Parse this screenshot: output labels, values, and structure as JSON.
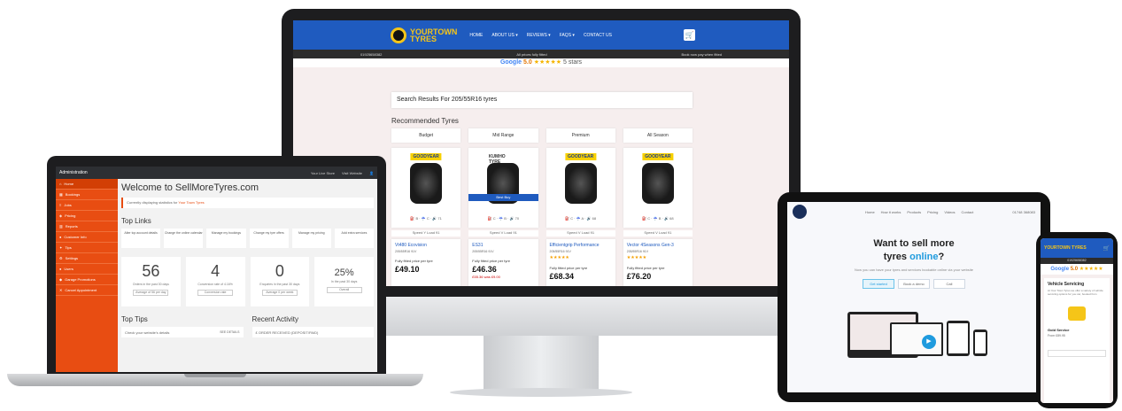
{
  "imac": {
    "logo_line1": "YOURTOWN",
    "logo_line2": "TYRES",
    "menu": [
      "HOME",
      "ABOUT US ▾",
      "REVIEWS ▾",
      "FAQS ▾",
      "CONTACT US"
    ],
    "strip": [
      "01925658382",
      "All prices fully fitted",
      "Book now pay when fitted"
    ],
    "rating": {
      "brand": "Google",
      "score": "5.0",
      "stars": "★★★★★",
      "count": "5 stars"
    },
    "search_title": "Search Results For 205/55R16 tyres",
    "recommended": "Recommended Tyres",
    "columns": [
      {
        "header": "Budget",
        "brand": "GOODYEAR",
        "best_buy": "",
        "speed": "Speed Y    Load 91",
        "name": "Vt480 Ecovision",
        "size": "205/55R16 91V",
        "stars": "",
        "fitted": "Fully fitted price per tyre",
        "price": "£49.10",
        "old": ""
      },
      {
        "header": "Mid Range",
        "brand": "KUMHO TYRE",
        "best_buy": "Best Buy",
        "speed": "Speed V    Load 91",
        "name": "ES31",
        "size": "205/55R16 91V",
        "stars": "",
        "fitted": "Fully fitted price per tyre",
        "price": "£46.36",
        "old": "£55.36 was £9.00"
      },
      {
        "header": "Premium",
        "brand": "GOODYEAR",
        "best_buy": "",
        "speed": "Speed V    Load 91",
        "name": "Efficientgrip Performance",
        "size": "205/55R16 91V",
        "stars": "★★★★★",
        "fitted": "Fully fitted price per tyre",
        "price": "£68.34",
        "old": ""
      },
      {
        "header": "All Season",
        "brand": "GOODYEAR",
        "best_buy": "",
        "speed": "Speed V    Load 91",
        "name": "Vector 4Seasons Gen-3",
        "size": "205/55R16 91V",
        "stars": "★★★★★",
        "fitted": "Fully fitted price per tyre",
        "price": "£76.20",
        "old": ""
      }
    ]
  },
  "laptop": {
    "topbar_title": "Administration",
    "topbar_right": [
      "Your Live Store",
      "Visit Website"
    ],
    "sidebar": [
      "Home",
      "Bookings",
      "Jobs",
      "Pricing",
      "Reports",
      "Customer Info",
      "Tips",
      "Settings",
      "Users",
      "Garage Promotions",
      "Cancel Appointment"
    ],
    "welcome": "Welcome to SellMoreTyres.com",
    "note_text": "Currently displaying statistics for ",
    "note_link": "Your Town Tyres",
    "top_links_heading": "Top Links",
    "top_links": [
      "Alter top account details",
      "Change the online calendar",
      "Manage my bookings",
      "Change my tyre offers",
      "Manage my pricing",
      "Add extra services"
    ],
    "stats": [
      {
        "num": "56",
        "lbl": "Orders in the past 30 days",
        "btn": "Average of 56 per day"
      },
      {
        "num": "4",
        "lbl": "Conversion rate of 4.16%",
        "btn": "Conversion rate"
      },
      {
        "num": "0",
        "lbl": "Enquiries in the past 30 days",
        "btn": "Average 0 per week"
      },
      {
        "num": "25%",
        "lbl": "In the past 30 days",
        "btn": "Overall"
      }
    ],
    "top_tips": "Top Tips",
    "tip_text": "Check your website's details",
    "tip_btn": "SEE DETAILS",
    "recent_activity": "Recent Activity",
    "activity_text": "ORDER RECEIVED (DEPOSIT/PAID)"
  },
  "tablet": {
    "menu": [
      "Home",
      "How it works",
      "Products",
      "Pricing",
      "Videos",
      "Contact"
    ],
    "phone": "01748 368083",
    "headline_1": "Want to sell more",
    "headline_2a": "tyres ",
    "headline_2b": "online",
    "headline_2c": "?",
    "sub": "Now you can have your tyres and services bookable online via your website",
    "buttons": [
      "Get started",
      "Book a demo",
      "Call"
    ]
  },
  "phone_device": {
    "logo": "YOURTOWN TYRES",
    "strip": "01925658382",
    "rating": {
      "brand": "Google",
      "score": "5.0",
      "stars": "★★★★★",
      "count": "5 stars"
    },
    "title": "Vehicle Servicing",
    "desc": "At Your Town Tyres we offer a variety of vehicle servicing options for you car, booked from",
    "service": "Gold Service",
    "from": "From £89.95"
  }
}
